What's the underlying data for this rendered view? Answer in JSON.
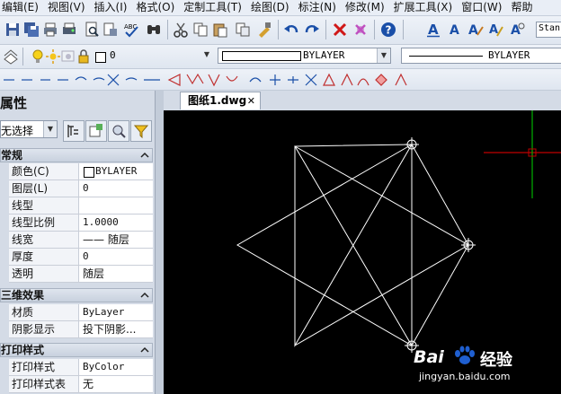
{
  "menu": {
    "items": [
      "编辑(E)",
      "视图(V)",
      "插入(I)",
      "格式(O)",
      "定制工具(T)",
      "绘图(D)",
      "标注(N)",
      "修改(M)",
      "扩展工具(X)",
      "窗口(W)",
      "帮助"
    ]
  },
  "toolbar": {
    "style_combo": "Stan",
    "layer_combo_value": "0",
    "color_combo_value": "BYLAYER",
    "linetype_combo_value": "BYLAYER"
  },
  "properties": {
    "title": "属性",
    "selection": "无选择",
    "sections": {
      "general": {
        "title": "常规",
        "rows": [
          {
            "key": "颜色(C)",
            "value": "BYLAYER"
          },
          {
            "key": "图层(L)",
            "value": "0"
          },
          {
            "key": "线型",
            "value": ""
          },
          {
            "key": "线型比例",
            "value": "1.0000"
          },
          {
            "key": "线宽",
            "value": "—— 随层"
          },
          {
            "key": "厚度",
            "value": "0"
          },
          {
            "key": "透明",
            "value": "随层"
          }
        ]
      },
      "threed": {
        "title": "三维效果",
        "rows": [
          {
            "key": "材质",
            "value": "ByLayer"
          },
          {
            "key": "阴影显示",
            "value": "投下阴影..."
          }
        ]
      },
      "plot": {
        "title": "打印样式",
        "rows": [
          {
            "key": "打印样式",
            "value": "ByColor"
          },
          {
            "key": "打印样式表",
            "value": "无"
          }
        ]
      }
    }
  },
  "tabs": [
    {
      "label": "图纸1.dwg",
      "close": "✕"
    }
  ],
  "watermark": {
    "brand": "Bai",
    "brand_cn": "经验",
    "url": "jingyan.baidu.com"
  },
  "colors": {
    "canvas": "#000000",
    "drawing": "#ffffff",
    "crosshair_h": "#c00000",
    "crosshair_v": "#00b000"
  }
}
